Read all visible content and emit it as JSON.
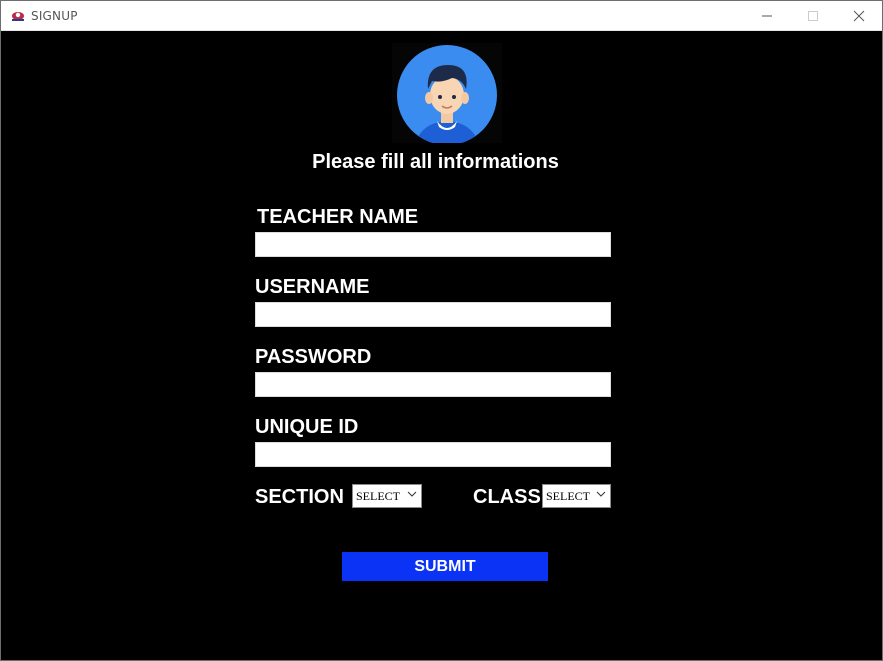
{
  "window": {
    "title": "SIGNUP"
  },
  "form": {
    "heading": "Please fill all informations",
    "teacher_name_label": "TEACHER NAME",
    "teacher_name_value": "",
    "username_label": "USERNAME",
    "username_value": "",
    "password_label": "PASSWORD",
    "password_value": "",
    "unique_id_label": "UNIQUE ID",
    "unique_id_value": "",
    "section_label": "SECTION",
    "section_value": "SELECT",
    "class_label": "CLASS",
    "class_value": "SELECT",
    "submit_label": "SUBMIT"
  },
  "icons": {
    "app": "app-logo-icon",
    "avatar": "user-avatar-icon",
    "minimize": "minimize-icon",
    "maximize": "maximize-icon",
    "close": "close-icon",
    "dropdown": "chevron-down-icon"
  },
  "colors": {
    "background": "#000000",
    "submit": "#0b33f5",
    "avatar_circle": "#3a8cf0",
    "text": "#ffffff"
  }
}
